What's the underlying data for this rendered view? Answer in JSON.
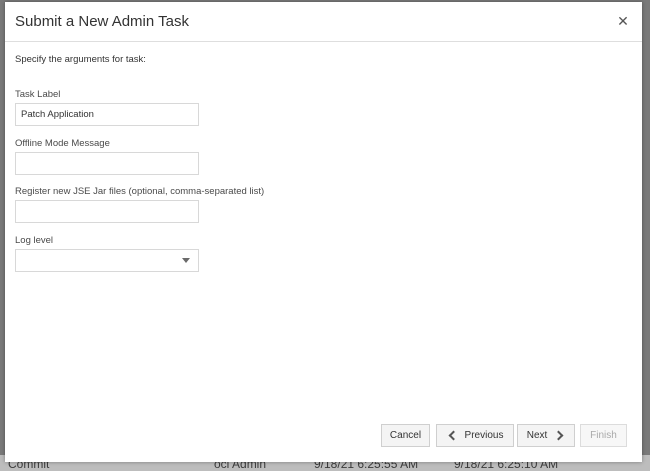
{
  "background_row": {
    "cells": [
      "Commit",
      "oci Admin",
      "9/18/21 6:25:55 AM",
      "9/18/21 6:25:10 AM"
    ]
  },
  "dialog": {
    "title": "Submit a New Admin Task",
    "close_icon": "close-icon",
    "instructions": "Specify the arguments for task:",
    "fields": {
      "task_label": {
        "label": "Task Label",
        "value": "Patch Application"
      },
      "offline_message": {
        "label": "Offline Mode Message",
        "value": ""
      },
      "jar_files": {
        "label": "Register new JSE Jar files (optional, comma-separated list)",
        "value": ""
      },
      "log_level": {
        "label": "Log level",
        "value": ""
      }
    },
    "buttons": {
      "cancel": "Cancel",
      "previous": "Previous",
      "next": "Next",
      "finish": "Finish"
    }
  },
  "colors": {
    "overlay": "#7a7a7a",
    "dialog_bg": "#ffffff",
    "button_bg": "#f4f4f4",
    "disabled_text": "#a9a9a9"
  }
}
